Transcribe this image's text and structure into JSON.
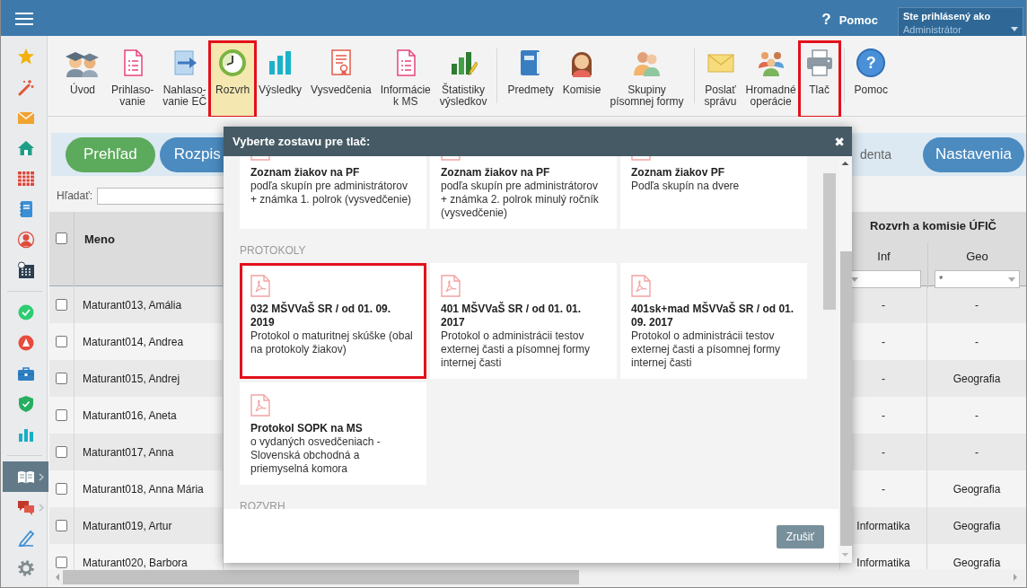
{
  "topbar": {
    "help": {
      "icon": "?",
      "label": "Pomoc"
    },
    "user": {
      "caption": "Ste prihlásený ako",
      "name": "Administrátor"
    }
  },
  "sidebar": {
    "groups": [
      {
        "items": [
          {
            "selected": false,
            "expandable": false
          },
          {
            "selected": false,
            "expandable": false
          },
          {
            "selected": false,
            "expandable": false
          },
          {
            "selected": false,
            "expandable": false
          },
          {
            "selected": false,
            "expandable": false
          },
          {
            "selected": false,
            "expandable": false
          },
          {
            "selected": false,
            "expandable": false
          },
          {
            "selected": false,
            "expandable": false
          }
        ]
      },
      {
        "items": [
          {
            "selected": false,
            "expandable": false
          },
          {
            "selected": false,
            "expandable": false
          },
          {
            "selected": false,
            "expandable": false
          },
          {
            "selected": false,
            "expandable": false
          },
          {
            "selected": false,
            "expandable": false
          }
        ]
      },
      {
        "items": [
          {
            "selected": true,
            "expandable": true
          },
          {
            "selected": false,
            "expandable": true
          },
          {
            "selected": false,
            "expandable": false
          },
          {
            "selected": false,
            "expandable": false
          }
        ]
      }
    ]
  },
  "toolbar": {
    "groups": [
      {
        "items": [
          {
            "label": "Úvod",
            "selected": false,
            "highlighted": false
          },
          {
            "label": "Prihlaso-\nvanie",
            "selected": false,
            "highlighted": false
          },
          {
            "label": "Nahlaso-\nvanie EČ",
            "selected": false,
            "highlighted": false
          },
          {
            "label": "Rozvrh",
            "selected": true,
            "highlighted": true
          },
          {
            "label": "Výsledky",
            "selected": false,
            "highlighted": false
          },
          {
            "label": "Vysvedčenia",
            "selected": false,
            "highlighted": false
          },
          {
            "label": "Informácie\nk MS",
            "selected": false,
            "highlighted": false
          },
          {
            "label": "Štatistiky\nvýsledkov",
            "selected": false,
            "highlighted": false
          }
        ]
      },
      {
        "items": [
          {
            "label": "Predmety",
            "selected": false,
            "highlighted": false
          },
          {
            "label": "Komisie",
            "selected": false,
            "highlighted": false
          },
          {
            "label": "Skupiny\npísomnej formy",
            "selected": false,
            "highlighted": false
          }
        ]
      },
      {
        "items": [
          {
            "label": "Poslať\nsprávu",
            "selected": false,
            "highlighted": false
          },
          {
            "label": "Hromadné\noperácie",
            "selected": false,
            "highlighted": false
          },
          {
            "label": "Tlač",
            "selected": false,
            "highlighted": true
          }
        ]
      },
      {
        "items": [
          {
            "label": "Pomoc",
            "glyph": "?",
            "selected": false,
            "highlighted": false
          }
        ]
      }
    ]
  },
  "tabs": [
    {
      "label": "Prehľad",
      "kind": "pill",
      "selected": true
    },
    {
      "label": "Rozpis",
      "kind": "pill",
      "selected": false
    },
    {
      "label": "denta",
      "kind": "plain",
      "selected": false
    },
    {
      "label": "Nastavenia",
      "kind": "pill",
      "selected": false
    }
  ],
  "search": {
    "label": "Hľadať:"
  },
  "table": {
    "select_all_checked": false,
    "name_column": "Meno",
    "group_header": "Rozvrh a komisie ÚFIČ",
    "group_columns": [
      {
        "label": "Inf"
      },
      {
        "label": "Geo",
        "filter": "*"
      }
    ],
    "rows": [
      {
        "name": "Maturant013, Amália",
        "checked": false,
        "inf": "-",
        "geo": "-"
      },
      {
        "name": "Maturant014, Andrea",
        "checked": false,
        "inf": "-",
        "geo": "-"
      },
      {
        "name": "Maturant015, Andrej",
        "checked": false,
        "inf": "-",
        "geo": "Geografia"
      },
      {
        "name": "Maturant016, Aneta",
        "checked": false,
        "inf": "-",
        "geo": "-"
      },
      {
        "name": "Maturant017, Anna",
        "checked": false,
        "inf": "-",
        "geo": "-"
      },
      {
        "name": "Maturant018, Anna Mária",
        "checked": false,
        "inf": "-",
        "geo": "Geografia"
      },
      {
        "name": "Maturant019, Artur",
        "checked": false,
        "inf": "Informatika",
        "geo": "Geografia"
      },
      {
        "name": "Maturant020, Barbora",
        "checked": false,
        "inf": "Informatika",
        "geo": "Geografia"
      }
    ]
  },
  "modal": {
    "title": "Vyberte zostavu pre tlač:",
    "close": "✖",
    "sections": [
      {
        "cards": [
          {
            "title": "Zoznam žiakov na PF",
            "description": "podľa skupín pre administrátorov + známka 1. polrok (vysvedčenie)",
            "highlighted": false
          },
          {
            "title": "Zoznam žiakov na PF",
            "description": "podľa skupín pre administrátorov + známka 2. polrok minulý ročník (vysvedčenie)",
            "highlighted": false
          },
          {
            "title": "Zoznam žiakov PF",
            "description": "Podľa skupín na dvere",
            "highlighted": false
          }
        ]
      },
      {
        "heading": "PROTOKOLY",
        "cards": [
          {
            "title": "032 MŠVVaŠ SR / od 01. 09. 2019",
            "description": "Protokol o maturitnej skúške (obal na protokoly žiakov)",
            "highlighted": true
          },
          {
            "title": "401 MŠVVaŠ SR / od 01. 01. 2017",
            "description": "Protokol o administrácii testov externej časti a písomnej formy internej časti",
            "highlighted": false
          },
          {
            "title": "401sk+mad MŠVVaŠ SR / od 01. 09. 2017",
            "description": "Protokol o administrácii testov externej časti a písomnej formy internej časti",
            "highlighted": false
          },
          {
            "title": "Protokol SOPK na MS",
            "description": "o vydaných osvedčeniach - Slovenská obchodná a priemyselná komora",
            "highlighted": false
          }
        ]
      },
      {
        "heading": "ROZVRH"
      }
    ],
    "buttons": [
      "Zrušiť"
    ]
  }
}
